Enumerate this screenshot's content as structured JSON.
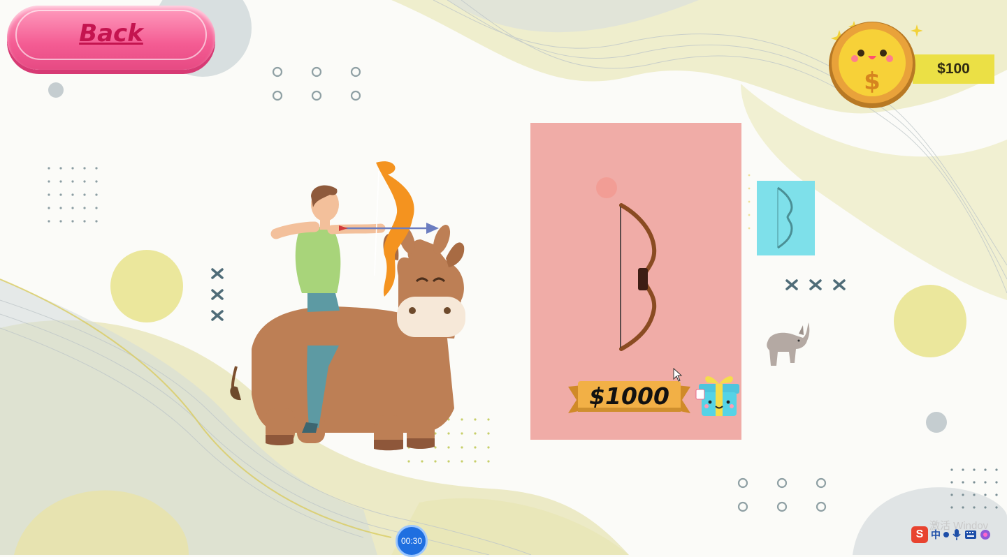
{
  "header": {
    "back_label": "Back"
  },
  "wallet": {
    "balance": "$100"
  },
  "shop": {
    "price": "$1000"
  },
  "timer": {
    "value": "00:30"
  },
  "system": {
    "watermark": "激活 Windov",
    "ime_label": "中"
  },
  "colors": {
    "back_button": "#f45c93",
    "panel": "#f0aca7",
    "thumb": "#7ee0ea",
    "money_bar": "#ebe045",
    "timer": "#1f6fe0"
  },
  "icons": [
    "coin-icon",
    "bow-icon",
    "gift-icon",
    "ime-icon",
    "mic-icon",
    "keyboard-icon"
  ]
}
